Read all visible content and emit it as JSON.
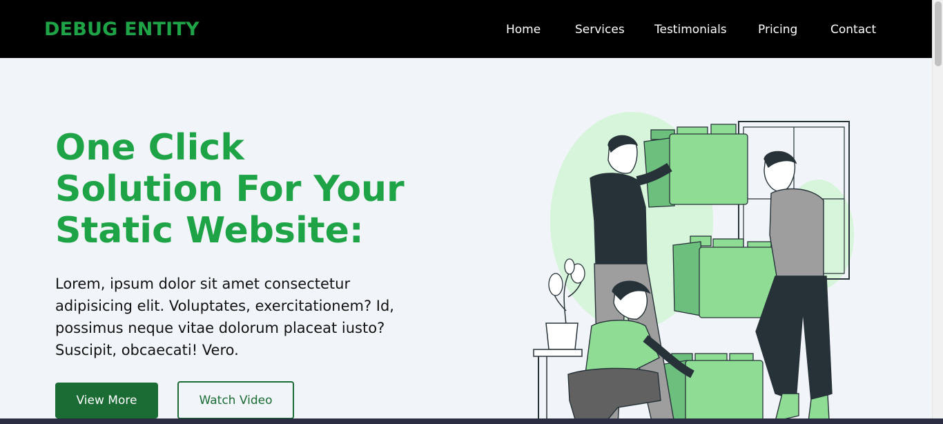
{
  "navbar": {
    "logo": "DEBUG ENTITY",
    "links": [
      {
        "label": "Home"
      },
      {
        "label": "Services"
      },
      {
        "label": "Testimonials"
      },
      {
        "label": "Pricing"
      },
      {
        "label": "Contact"
      }
    ]
  },
  "hero": {
    "title_lines": [
      "One Click",
      "Solution For Your",
      "Static Website:"
    ],
    "description": "Lorem, ipsum dolor sit amet consectetur adipisicing elit. Voluptates, exercitationem? Id, possimus neque vitae dolorum placeat iusto? Suscipit, obcaecati! Vero.",
    "primary_button": "View More",
    "secondary_button": "Watch Video"
  },
  "colors": {
    "brand_green": "#1ea346",
    "button_green": "#1a6b34",
    "nav_background": "#000000",
    "page_background": "#f1f4f9",
    "illustration_light_green": "#8fdc95",
    "illustration_dark": "#263238"
  },
  "illustration": {
    "icon": "people-stacking-blocks-illustration"
  }
}
